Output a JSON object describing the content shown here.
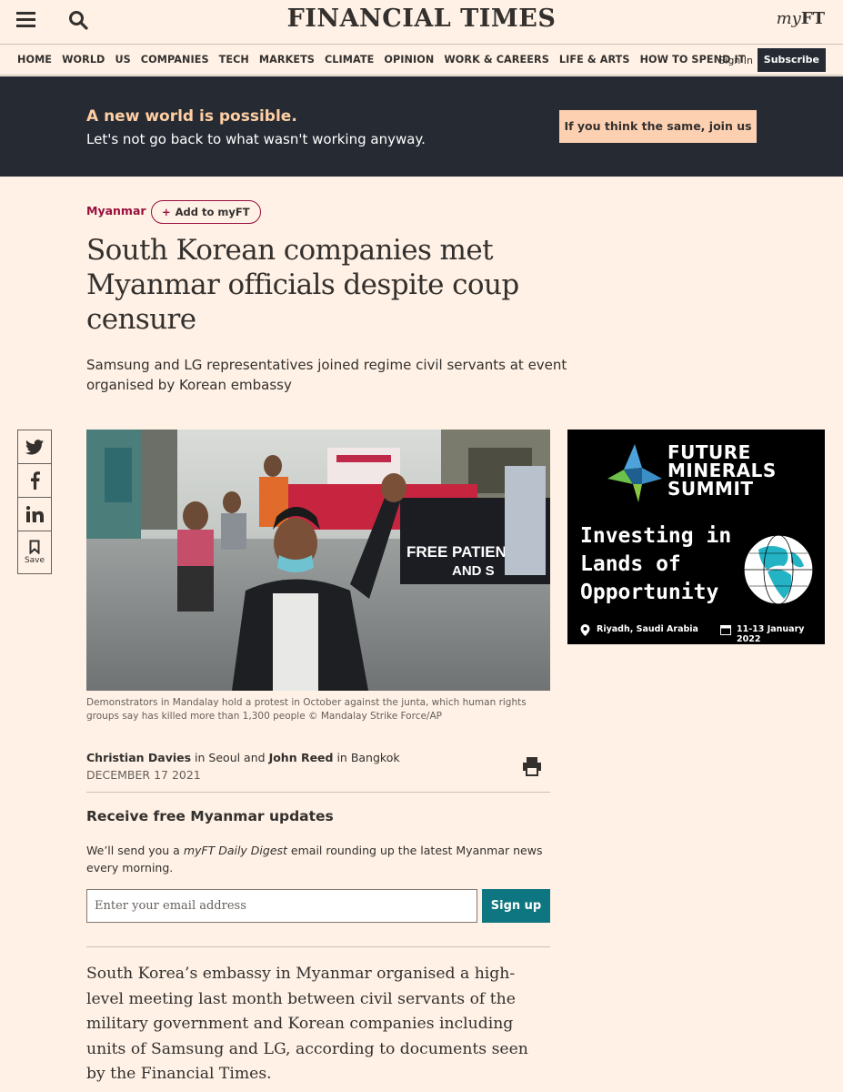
{
  "header": {
    "logo": "FINANCIAL TIMES",
    "myft_prefix": "my",
    "myft_suffix": "FT"
  },
  "nav": {
    "items": [
      "HOME",
      "WORLD",
      "US",
      "COMPANIES",
      "TECH",
      "MARKETS",
      "CLIMATE",
      "OPINION",
      "WORK & CAREERS",
      "LIFE & ARTS",
      "HOW TO SPEND IT"
    ],
    "sign_in": "Sign In",
    "subscribe": "Subscribe"
  },
  "banner": {
    "title": "A new world is possible.",
    "subtitle": "Let's not go back to what wasn't working anyway.",
    "cta": "If you think the same, join us"
  },
  "article": {
    "topic": "Myanmar",
    "add_myft": "Add to myFT",
    "headline": "South Korean companies met Myanmar officials despite coup censure",
    "standfirst": "Samsung and LG representatives joined regime civil servants at event organised by Korean embassy",
    "caption": "Demonstrators in Mandalay hold a protest in October against the junta, which human rights groups say has killed more than 1,300 people © Mandalay Strike Force/AP",
    "photo_signs": {
      "sign_1": "FREE PATIENTS",
      "sign_2": "AND S"
    },
    "byline": {
      "author1": "Christian Davies",
      "loc1": " in Seoul and ",
      "author2": "John Reed",
      "loc2": " in Bangkok ",
      "date": "DECEMBER 17 2021"
    },
    "body": "South Korea’s embassy in Myanmar organised a high-level meeting last month between civil servants of the military government and Korean companies including units of Samsung and LG, according to documents seen by the Financial Times."
  },
  "share": {
    "save_label": "Save",
    "icons": [
      "twitter-icon",
      "facebook-icon",
      "linkedin-icon",
      "bookmark-icon"
    ]
  },
  "newsletter": {
    "title": "Receive free Myanmar updates",
    "text_before": "We’ll send you a ",
    "text_italic": "myFT Daily Digest",
    "text_after": " email rounding up the latest Myanmar news every morning.",
    "email_placeholder": "Enter your email address",
    "signup": "Sign up"
  },
  "ad": {
    "title_line1": "FUTURE",
    "title_line2": "MINERALS",
    "title_line3": "SUMMIT",
    "tagline_line1": "Investing in",
    "tagline_line2": "Lands of",
    "tagline_line3": "Opportunity",
    "location": "Riyadh, Saudi Arabia",
    "dates": "11-13 January 2022"
  },
  "colors": {
    "background": "#fff1e5",
    "banner": "#262a33",
    "accent_claret": "#990f3d",
    "teal": "#0d7680",
    "banner_button": "#fcd0b1"
  }
}
